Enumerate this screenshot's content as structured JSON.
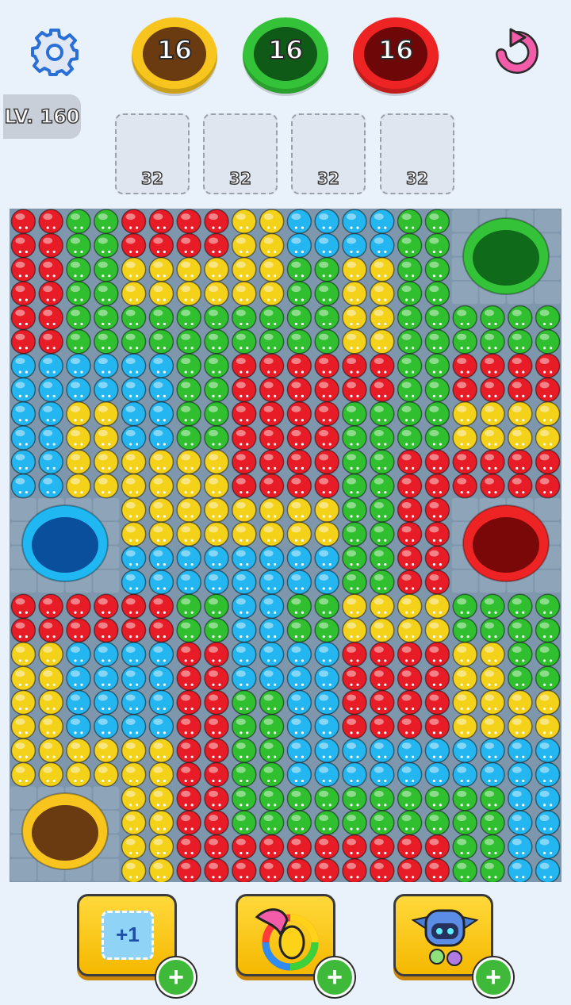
{
  "header": {
    "holes": [
      {
        "count": "16",
        "color": "yellow",
        "rim": "#f7c51e",
        "inner": "#6a3a10"
      },
      {
        "count": "16",
        "color": "green",
        "rim": "#33c238",
        "inner": "#0f5a17"
      },
      {
        "count": "16",
        "color": "red",
        "rim": "#ee2323",
        "inner": "#6e0707"
      }
    ]
  },
  "level_label": "LV. 160",
  "slots": [
    "32",
    "32",
    "32",
    "32"
  ],
  "board": {
    "rows": [
      "RRGGRRRRYYCCCCGG....",
      "RRGGRRRRYYCCCCGG....",
      "RRGGYYYYYYGGYYGG....",
      "RRGGYYYYYYGGYYGG....",
      "RRGGGGGGGGGGYYGGGGGG",
      "RRGGGGGGGGGGYYGGGGGG",
      "CCCCCCGGRRRRRRGGRRRR",
      "CCCCCCGGRRRRRRGGRRRR",
      "CCYYCCGGRRRRGGGGYYYY",
      "CCYYCCGGRRRRGGGGYYYY",
      "CCYYYYYYRRRRGGRRRRRR",
      "CCYYYYYYRRRRGGRRRRRR",
      "....YYYYYYYYGGRR....",
      "....YYYYYYYYGGRR....",
      "....CCCCCCCCGGRR....",
      "....CCCCCCCCGGRR....",
      "RRRRRRGGCCGGYYYYGGGG",
      "RRRRRRGGCCGGYYYYGGGG",
      "YYCCCCRRCCCCRRRRYYGG",
      "YYCCCCRRCCCCRRRRYYGG",
      "YYCCCCRRGGCCRRRRYYYY",
      "YYCCCCRRGGCCRRRRYYYY",
      "YYYYYYRRGGCCCCCCCCCC",
      "YYYYYYRRGGCCCCCCCCCC",
      "....YYRRGGGGGGGGGGCC",
      "....YYRRGGGGGGGGGGCC",
      "....YYRRRRRRRRRRGGCC",
      "....YYRRRRRRRRRRGGCC"
    ],
    "colors": {
      "R": "#e81c26",
      "G": "#2fbf2f",
      "Y": "#f5d21a",
      "C": "#23b6f0"
    },
    "holes": [
      {
        "color": "green",
        "rim": "#33c238",
        "inner": "#0f6a1a"
      },
      {
        "color": "blue",
        "rim": "#1fb8f2",
        "inner": "#0a4f9c"
      },
      {
        "color": "red",
        "rim": "#ee2323",
        "inner": "#7a0808"
      },
      {
        "color": "brown",
        "rim": "#f7c51e",
        "inner": "#6a3a10"
      }
    ]
  },
  "powerups": [
    {
      "label": "+1",
      "icon": "add-slot-icon"
    },
    {
      "icon": "color-brush-icon"
    },
    {
      "icon": "robot-icon"
    }
  ]
}
